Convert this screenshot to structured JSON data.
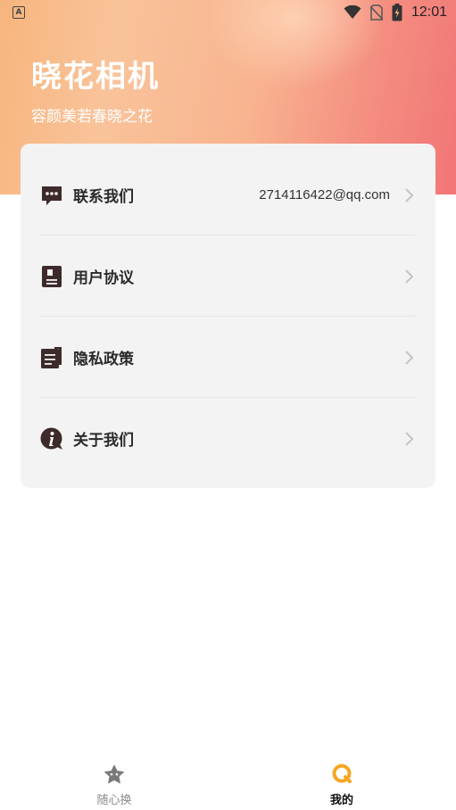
{
  "status_bar": {
    "time": "12:01",
    "left_badge": "A"
  },
  "header": {
    "title": "晓花相机",
    "subtitle": "容颜美若春晓之花"
  },
  "menu": {
    "items": [
      {
        "id": "contact",
        "label": "联系我们",
        "value": "2714116422@qq.com",
        "icon": "message-icon"
      },
      {
        "id": "agreement",
        "label": "用户协议",
        "value": "",
        "icon": "book-icon"
      },
      {
        "id": "privacy",
        "label": "隐私政策",
        "value": "",
        "icon": "document-icon"
      },
      {
        "id": "about",
        "label": "关于我们",
        "value": "",
        "icon": "info-icon"
      }
    ]
  },
  "tabbar": {
    "tabs": [
      {
        "label": "随心换",
        "active": false,
        "icon": "star-face-icon"
      },
      {
        "label": "我的",
        "active": true,
        "icon": "profile-ring-icon"
      }
    ]
  },
  "colors": {
    "accent": "#f5a623",
    "icon_dark": "#3d2a2a",
    "header_start": "#f7b57d",
    "header_end": "#f17576"
  }
}
